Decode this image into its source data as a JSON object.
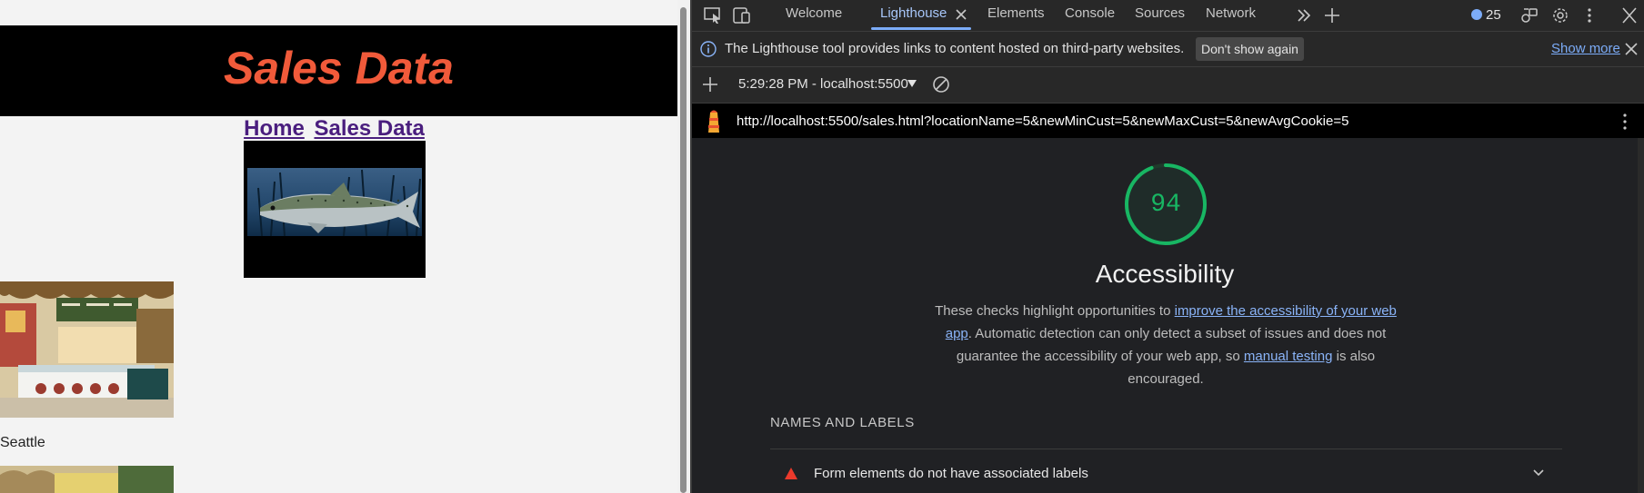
{
  "page": {
    "header_title": "Sales Data",
    "nav": [
      {
        "label": "Home"
      },
      {
        "label": "Sales Data"
      }
    ],
    "city_label": "Seattle"
  },
  "devtools": {
    "tabs": [
      {
        "label": "Welcome"
      },
      {
        "label": "Lighthouse"
      },
      {
        "label": "Elements"
      },
      {
        "label": "Console"
      },
      {
        "label": "Sources"
      },
      {
        "label": "Network"
      }
    ],
    "issues_count": "25",
    "infobar": {
      "text": "The Lighthouse tool provides links to content hosted on third-party websites.",
      "dont_show_label": "Don't show again",
      "show_more_label": "Show more"
    },
    "report_selector": "5:29:28 PM - localhost:5500",
    "url": "http://localhost:5500/sales.html?locationName=5&newMinCust=5&newMaxCust=5&newAvgCookie=5",
    "category": {
      "score": "94",
      "score_fraction": 0.94,
      "title": "Accessibility",
      "desc_1": "These checks highlight opportunities to ",
      "desc_link_1": "improve the accessibility of your web app",
      "desc_2": ". Automatic detection can only detect a subset of issues and does not guarantee the accessibility of your web app, so ",
      "desc_link_2": "manual testing",
      "desc_3": " is also encouraged."
    },
    "group_title": "NAMES AND LABELS",
    "audits": [
      {
        "title": "Form elements do not have associated labels",
        "status": "fail"
      }
    ]
  },
  "colors": {
    "page_bg": "#f3f3f3",
    "header_bg": "#000000",
    "title_color": "#f15a3a",
    "nav_link": "#4a1e7e",
    "devtools_bg": "#202124",
    "accent_blue": "#7cacf8",
    "score_green": "#18b663",
    "fail_red": "#eb3a2c"
  }
}
